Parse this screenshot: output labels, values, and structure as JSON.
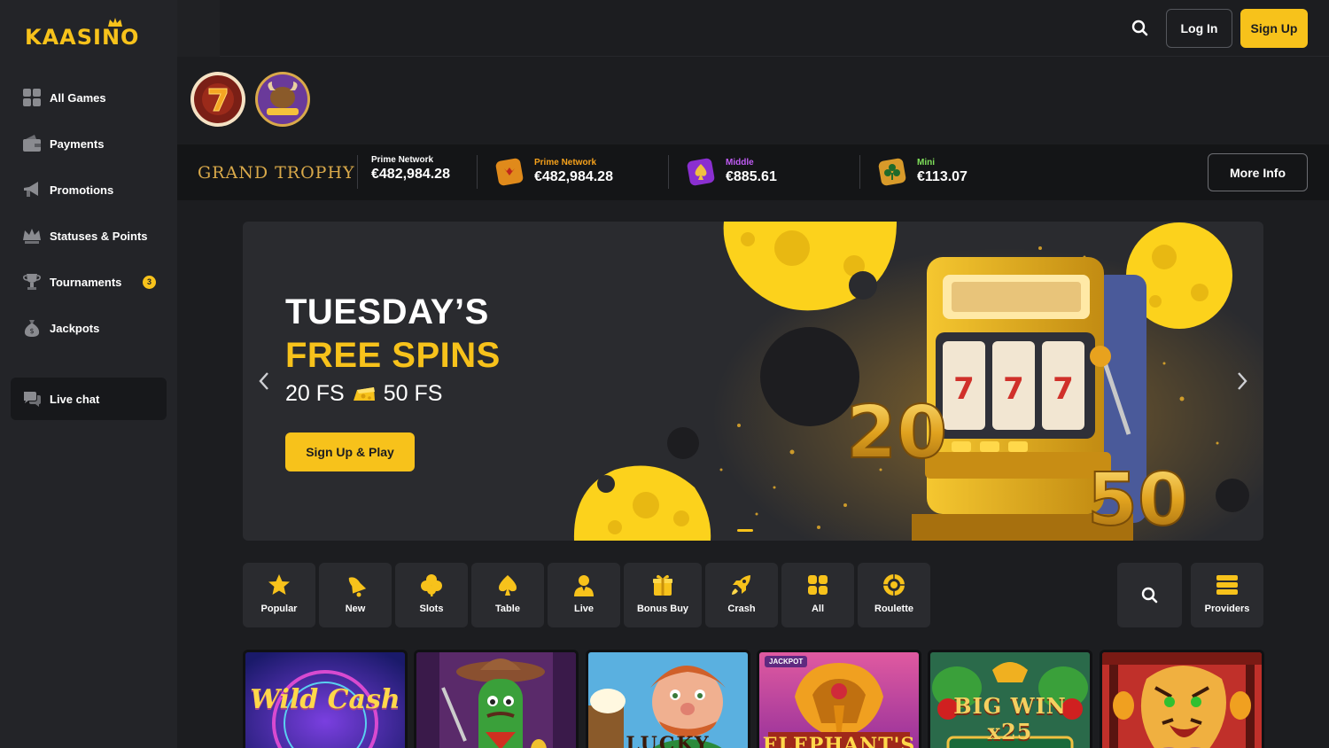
{
  "brand": {
    "logo_text": "KAASINO",
    "accent": "#f7c21b"
  },
  "sidebar": {
    "items": [
      {
        "label": "All Games",
        "icon": "grid-icon"
      },
      {
        "label": "Payments",
        "icon": "wallet-icon"
      },
      {
        "label": "Promotions",
        "icon": "megaphone-icon"
      },
      {
        "label": "Statuses & Points",
        "icon": "crown-icon"
      },
      {
        "label": "Tournaments",
        "icon": "trophy-icon",
        "badge": "3"
      },
      {
        "label": "Jackpots",
        "icon": "money-bag-icon"
      }
    ],
    "live_chat": "Live chat"
  },
  "header": {
    "login": "Log In",
    "signup": "Sign Up"
  },
  "jackpot": {
    "title": "GRAND TROPHY",
    "items": [
      {
        "name": "Prime Network",
        "value": "€482,984.28",
        "color": "#ffffff"
      },
      {
        "name": "Prime Network",
        "value": "€482,984.28",
        "color": "#f7a21b"
      },
      {
        "name": "Middle",
        "value": "€885.61",
        "color": "#c05cf5"
      },
      {
        "name": "Mini",
        "value": "€113.07",
        "color": "#7fe05a"
      }
    ],
    "more_info": "More Info"
  },
  "banner": {
    "line1": "TUESDAY’S",
    "line2": "FREE SPINS",
    "fs_a": "20 FS",
    "fs_b": "50 FS",
    "cta": "Sign Up & Play",
    "num_a": "20",
    "num_b": "50"
  },
  "categories": [
    {
      "label": "Popular",
      "icon": "star-icon"
    },
    {
      "label": "New",
      "icon": "bell-icon"
    },
    {
      "label": "Slots",
      "icon": "clover-icon"
    },
    {
      "label": "Table",
      "icon": "spade-icon"
    },
    {
      "label": "Live",
      "icon": "dealer-icon"
    },
    {
      "label": "Bonus Buy",
      "icon": "gift-icon"
    },
    {
      "label": "Crash",
      "icon": "rocket-icon"
    },
    {
      "label": "All",
      "icon": "grid-icon"
    },
    {
      "label": "Roulette",
      "icon": "roulette-icon"
    }
  ],
  "providers": "Providers",
  "games": [
    {
      "title": "Wild Cash"
    },
    {
      "title": ""
    },
    {
      "title": "LUCKY"
    },
    {
      "title": "ELEPHANT'S",
      "badge": "JACKPOT"
    },
    {
      "title": "BIG WIN x25"
    },
    {
      "title": ""
    }
  ]
}
